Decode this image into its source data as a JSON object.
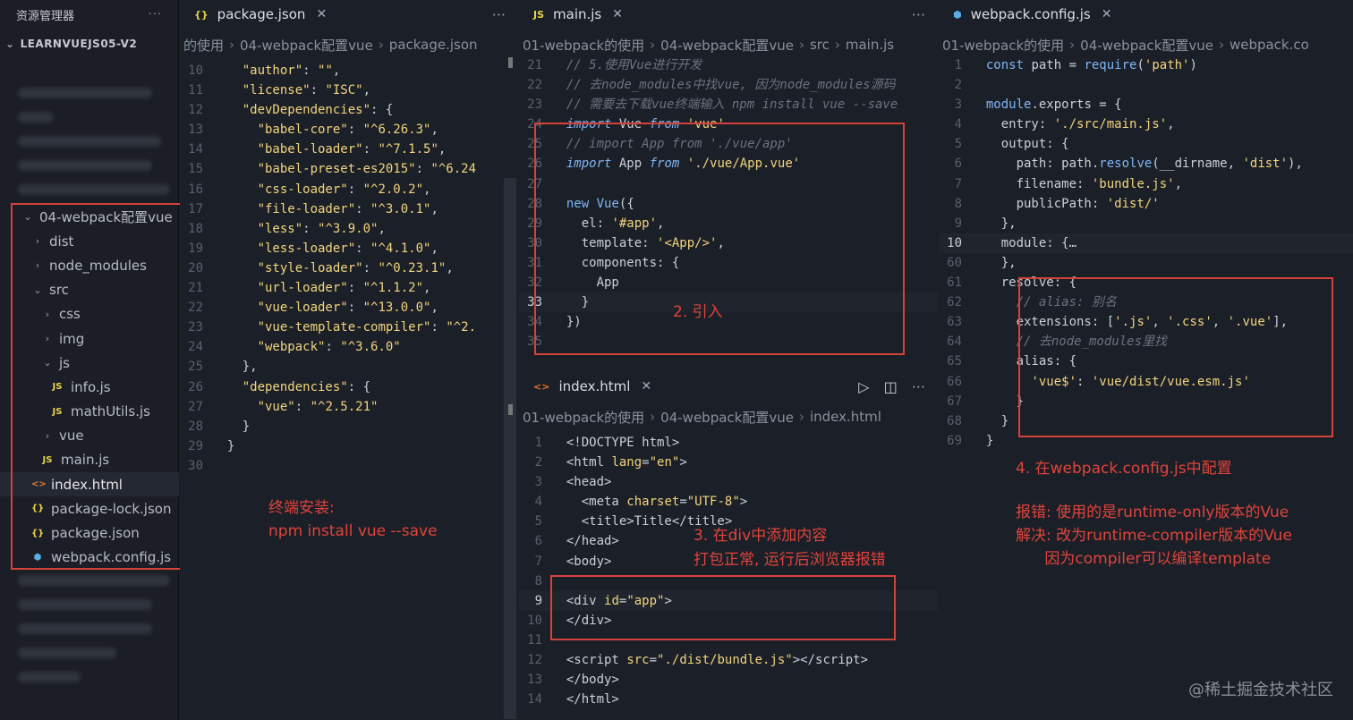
{
  "explorer": {
    "title": "资源管理器",
    "more": "···",
    "root": "LEARNVUEJS05-V2",
    "tree": [
      {
        "label": "04-webpack配置vue",
        "kind": "folder-open",
        "indent": 0
      },
      {
        "label": "dist",
        "kind": "folder",
        "indent": 1
      },
      {
        "label": "node_modules",
        "kind": "folder",
        "indent": 1
      },
      {
        "label": "src",
        "kind": "folder-open",
        "indent": 1
      },
      {
        "label": "css",
        "kind": "folder",
        "indent": 2
      },
      {
        "label": "img",
        "kind": "folder",
        "indent": 2
      },
      {
        "label": "js",
        "kind": "folder-open",
        "indent": 2
      },
      {
        "label": "info.js",
        "kind": "js",
        "indent": 3
      },
      {
        "label": "mathUtils.js",
        "kind": "js",
        "indent": 3
      },
      {
        "label": "vue",
        "kind": "folder",
        "indent": 2
      },
      {
        "label": "main.js",
        "kind": "js",
        "indent": 2
      },
      {
        "label": "index.html",
        "kind": "html",
        "indent": 1
      },
      {
        "label": "package-lock.json",
        "kind": "json",
        "indent": 1
      },
      {
        "label": "package.json",
        "kind": "json",
        "indent": 1
      },
      {
        "label": "webpack.config.js",
        "kind": "config",
        "indent": 1
      }
    ]
  },
  "pane_package": {
    "tab": "package.json",
    "tab_icon": "{}",
    "more": "···",
    "crumbs": [
      "的使用",
      "04-webpack配置vue",
      "package.json"
    ],
    "lines": [
      {
        "n": "10",
        "html": "    <span class=\"key\">\"author\"</span>: <span class=\"str\">\"\"</span>,"
      },
      {
        "n": "11",
        "html": "    <span class=\"key\">\"license\"</span>: <span class=\"str\">\"ISC\"</span>,"
      },
      {
        "n": "12",
        "html": "    <span class=\"key\">\"devDependencies\"</span>: {"
      },
      {
        "n": "13",
        "html": "      <span class=\"key\">\"babel-core\"</span>: <span class=\"str\">\"^6.26.3\"</span>,"
      },
      {
        "n": "14",
        "html": "      <span class=\"key\">\"babel-loader\"</span>: <span class=\"str\">\"^7.1.5\"</span>,"
      },
      {
        "n": "15",
        "html": "      <span class=\"key\">\"babel-preset-es2015\"</span>: <span class=\"str\">\"^6.24</span>"
      },
      {
        "n": "16",
        "html": "      <span class=\"key\">\"css-loader\"</span>: <span class=\"str\">\"^2.0.2\"</span>,"
      },
      {
        "n": "17",
        "html": "      <span class=\"key\">\"file-loader\"</span>: <span class=\"str\">\"^3.0.1\"</span>,"
      },
      {
        "n": "18",
        "html": "      <span class=\"key\">\"less\"</span>: <span class=\"str\">\"^3.9.0\"</span>,"
      },
      {
        "n": "19",
        "html": "      <span class=\"key\">\"less-loader\"</span>: <span class=\"str\">\"^4.1.0\"</span>,"
      },
      {
        "n": "20",
        "html": "      <span class=\"key\">\"style-loader\"</span>: <span class=\"str\">\"^0.23.1\"</span>,"
      },
      {
        "n": "21",
        "html": "      <span class=\"key\">\"url-loader\"</span>: <span class=\"str\">\"^1.1.2\"</span>,"
      },
      {
        "n": "22",
        "html": "      <span class=\"key\">\"vue-loader\"</span>: <span class=\"str\">\"^13.0.0\"</span>,"
      },
      {
        "n": "23",
        "html": "      <span class=\"key\">\"vue-template-compiler\"</span>: <span class=\"str\">\"^2.</span>"
      },
      {
        "n": "24",
        "html": "      <span class=\"key\">\"webpack\"</span>: <span class=\"str\">\"^3.6.0\"</span>"
      },
      {
        "n": "25",
        "html": "    },"
      },
      {
        "n": "26",
        "html": "    <span class=\"key\">\"dependencies\"</span>: {"
      },
      {
        "n": "27",
        "html": "      <span class=\"key\">\"vue\"</span>: <span class=\"str\">\"^2.5.21\"</span>"
      },
      {
        "n": "28",
        "html": "    }"
      },
      {
        "n": "29",
        "html": "  }"
      },
      {
        "n": "30",
        "html": ""
      }
    ],
    "annotation": "终端安装:\nnpm install vue --save"
  },
  "pane_main": {
    "tab": "main.js",
    "tab_icon": "JS",
    "more": "···",
    "crumbs": [
      "01-webpack的使用",
      "04-webpack配置vue",
      "src",
      "main.js"
    ],
    "lines": [
      {
        "n": "21",
        "html": "  <span class=\"c\">// 5.使用Vue进行开发</span>"
      },
      {
        "n": "22",
        "html": "  <span class=\"c\">// 去node_modules中找vue, 因为node_modules源码</span>"
      },
      {
        "n": "23",
        "html": "  <span class=\"c\">// 需要去下载vue终端输入 npm install vue --save</span>"
      },
      {
        "n": "24",
        "html": "  <span class=\"k\"><i>import</i></span> Vue <span class=\"k\"><i>from</i></span> <span class=\"str\">'vue'</span>"
      },
      {
        "n": "25",
        "html": "  <span class=\"c\">// import App from './vue/app'</span>"
      },
      {
        "n": "26",
        "html": "  <span class=\"k\"><i>import</i></span> App <span class=\"k\"><i>from</i></span> <span class=\"str\">'./vue/App.vue'</span>"
      },
      {
        "n": "27",
        "html": ""
      },
      {
        "n": "28",
        "html": "  <span class=\"k\">new</span> <span class=\"fn\">Vue</span>({"
      },
      {
        "n": "29",
        "html": "    el: <span class=\"str\">'#app'</span>,"
      },
      {
        "n": "30",
        "html": "    template: <span class=\"str\">'&lt;App/&gt;'</span>,"
      },
      {
        "n": "31",
        "html": "    components: {"
      },
      {
        "n": "32",
        "html": "      App"
      },
      {
        "n": "33",
        "html": "    }"
      },
      {
        "n": "34",
        "html": "  })"
      },
      {
        "n": "35",
        "html": ""
      }
    ],
    "annotation": "2. 引入"
  },
  "pane_index": {
    "tab": "index.html",
    "tab_icon": "<>",
    "more": "···",
    "crumbs": [
      "01-webpack的使用",
      "04-webpack配置vue",
      "index.html"
    ],
    "lines": [
      {
        "n": "1",
        "html": "  &lt;!DOCTYPE html&gt;"
      },
      {
        "n": "2",
        "html": "  &lt;html <span class=\"key\">lang</span>=<span class=\"str\">\"en\"</span>&gt;"
      },
      {
        "n": "3",
        "html": "  &lt;head&gt;"
      },
      {
        "n": "4",
        "html": "    &lt;meta <span class=\"key\">charset</span>=<span class=\"str\">\"UTF-8\"</span>&gt;"
      },
      {
        "n": "5",
        "html": "    &lt;title&gt;Title&lt;/title&gt;"
      },
      {
        "n": "6",
        "html": "  &lt;/head&gt;"
      },
      {
        "n": "7",
        "html": "  &lt;body&gt;"
      },
      {
        "n": "8",
        "html": ""
      },
      {
        "n": "9",
        "html": "  &lt;div <span class=\"key\">id</span>=<span class=\"str\">\"app\"</span>&gt;"
      },
      {
        "n": "10",
        "html": "  &lt;/div&gt;"
      },
      {
        "n": "11",
        "html": ""
      },
      {
        "n": "12",
        "html": "  &lt;script <span class=\"key\">src</span>=<span class=\"str\">\"./dist/bundle.js\"</span>&gt;&lt;/script&gt;"
      },
      {
        "n": "13",
        "html": "  &lt;/body&gt;"
      },
      {
        "n": "14",
        "html": "  &lt;/html&gt;"
      }
    ],
    "annotation": "3. 在div中添加内容\n打包正常, 运行后浏览器报错"
  },
  "pane_webpack": {
    "tab": "webpack.config.js",
    "crumbs": [
      "01-webpack的使用",
      "04-webpack配置vue",
      "webpack.co"
    ],
    "lines": [
      {
        "n": "1",
        "html": "  <span class=\"k\">const</span> path = <span class=\"fn\">require</span>(<span class=\"str\">'path'</span>)"
      },
      {
        "n": "2",
        "html": ""
      },
      {
        "n": "3",
        "html": "  <span class=\"k\">module</span>.exports = {"
      },
      {
        "n": "4",
        "html": "    entry: <span class=\"str\">'./src/main.js'</span>,"
      },
      {
        "n": "5",
        "html": "    output: {"
      },
      {
        "n": "6",
        "html": "      path: path.<span class=\"fn\">resolve</span>(__dirname, <span class=\"str\">'dist'</span>),"
      },
      {
        "n": "7",
        "html": "      filename: <span class=\"str\">'bundle.js'</span>,"
      },
      {
        "n": "8",
        "html": "      publicPath: <span class=\"str\">'dist/'</span>"
      },
      {
        "n": "9",
        "html": "    },"
      },
      {
        "n": "10",
        "html": "    module: {…"
      },
      {
        "n": "60",
        "html": "    },"
      },
      {
        "n": "61",
        "html": "    resolve: {"
      },
      {
        "n": "62",
        "html": "      <span class=\"c\">// alias: 别名</span>"
      },
      {
        "n": "63",
        "html": "      extensions: [<span class=\"str\">'.js'</span>, <span class=\"str\">'.css'</span>, <span class=\"str\">'.vue'</span>],"
      },
      {
        "n": "64",
        "html": "      <span class=\"c\">// 去node_modules里找</span>"
      },
      {
        "n": "65",
        "html": "      alias: {"
      },
      {
        "n": "66",
        "html": "        <span class=\"str\">'vue$'</span>: <span class=\"str\">'vue/dist/vue.esm.js'</span>"
      },
      {
        "n": "67",
        "html": "      }"
      },
      {
        "n": "68",
        "html": "    }"
      },
      {
        "n": "69",
        "html": "  }"
      }
    ],
    "annotation1": "4. 在webpack.config.js中配置",
    "annotation2": "报错: 使用的是runtime-only版本的Vue\n解决: 改为runtime-compiler版本的Vue\n      因为compiler可以编译template"
  },
  "watermark": "@稀土掘金技术社区",
  "colors": {
    "annotation": "#e0443c",
    "box": "#d5423b",
    "bg": "#1b1f27"
  }
}
